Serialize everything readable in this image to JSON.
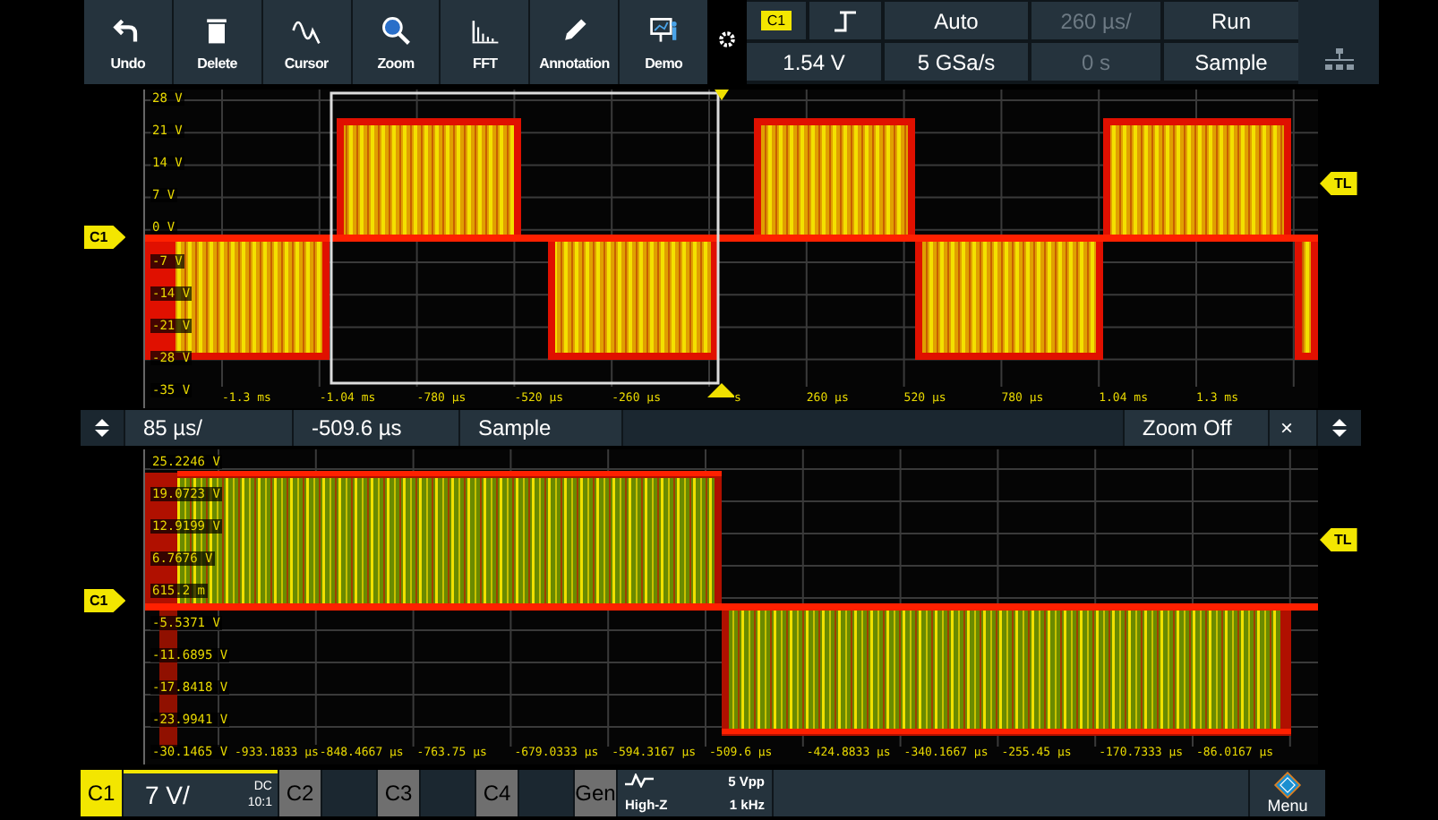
{
  "toolbar": {
    "buttons": [
      {
        "label": "Undo"
      },
      {
        "label": "Delete"
      },
      {
        "label": "Cursor"
      },
      {
        "label": "Zoom"
      },
      {
        "label": "FFT"
      },
      {
        "label": "Annotation"
      },
      {
        "label": "Demo"
      }
    ]
  },
  "acquisition_panel": {
    "trigger_source": "C1",
    "trigger_level": "1.54 V",
    "trigger_mode": "Auto",
    "sample_rate": "5 GSa/s",
    "timebase": {
      "text": "260 µs/",
      "disabled": true
    },
    "position": {
      "text": "0 s",
      "disabled": true
    },
    "run_state": "Run",
    "acquisition_mode": "Sample"
  },
  "upper_plot": {
    "channel_marker": "C1",
    "trigger_level_marker": "TL",
    "y_labels": [
      "28 V",
      "21 V",
      "14 V",
      "7 V",
      "0 V",
      "-7 V",
      "-14 V",
      "-21 V",
      "-28 V",
      "-35 V"
    ],
    "x_labels": [
      "-1.3 ms",
      "-1.04 ms",
      "-780 µs",
      "-520 µs",
      "-260 µs",
      "s",
      "260 µs",
      "520 µs",
      "780 µs",
      "1.04 ms",
      "1.3 ms"
    ]
  },
  "zoom_bar": {
    "scale": "85 µs/",
    "position": "-509.6 µs",
    "mode": "Sample",
    "zoom_state": "Zoom Off",
    "close": "×"
  },
  "lower_plot": {
    "channel_marker": "C1",
    "trigger_level_marker": "TL",
    "y_labels": [
      "25.2246 V",
      "19.0723 V",
      "12.9199 V",
      "6.7676 V",
      "615.2 m",
      "-5.5371 V",
      "-11.6895 V",
      "-17.8418 V",
      "-23.9941 V",
      "-30.1465 V"
    ],
    "x_labels": [
      "-933.1833 µs",
      "-848.4667 µs",
      "-763.75 µs",
      "-679.0333 µs",
      "-594.3167 µs",
      "-509.6 µs",
      "-424.8833 µs",
      "-340.1667 µs",
      "-255.45 µs",
      "-170.7333 µs",
      "-86.0167 µs"
    ]
  },
  "bottom_bar": {
    "channels": [
      {
        "label": "C1",
        "selected": true,
        "scale": "7 V/",
        "coupling": "DC",
        "probe": "10:1"
      },
      {
        "label": "C2",
        "selected": false
      },
      {
        "label": "C3",
        "selected": false
      },
      {
        "label": "C4",
        "selected": false
      }
    ],
    "generator": {
      "label": "Gen",
      "impedance": "High-Z",
      "amplitude": "5 Vpp",
      "frequency": "1 kHz"
    },
    "menu": "Menu"
  }
}
